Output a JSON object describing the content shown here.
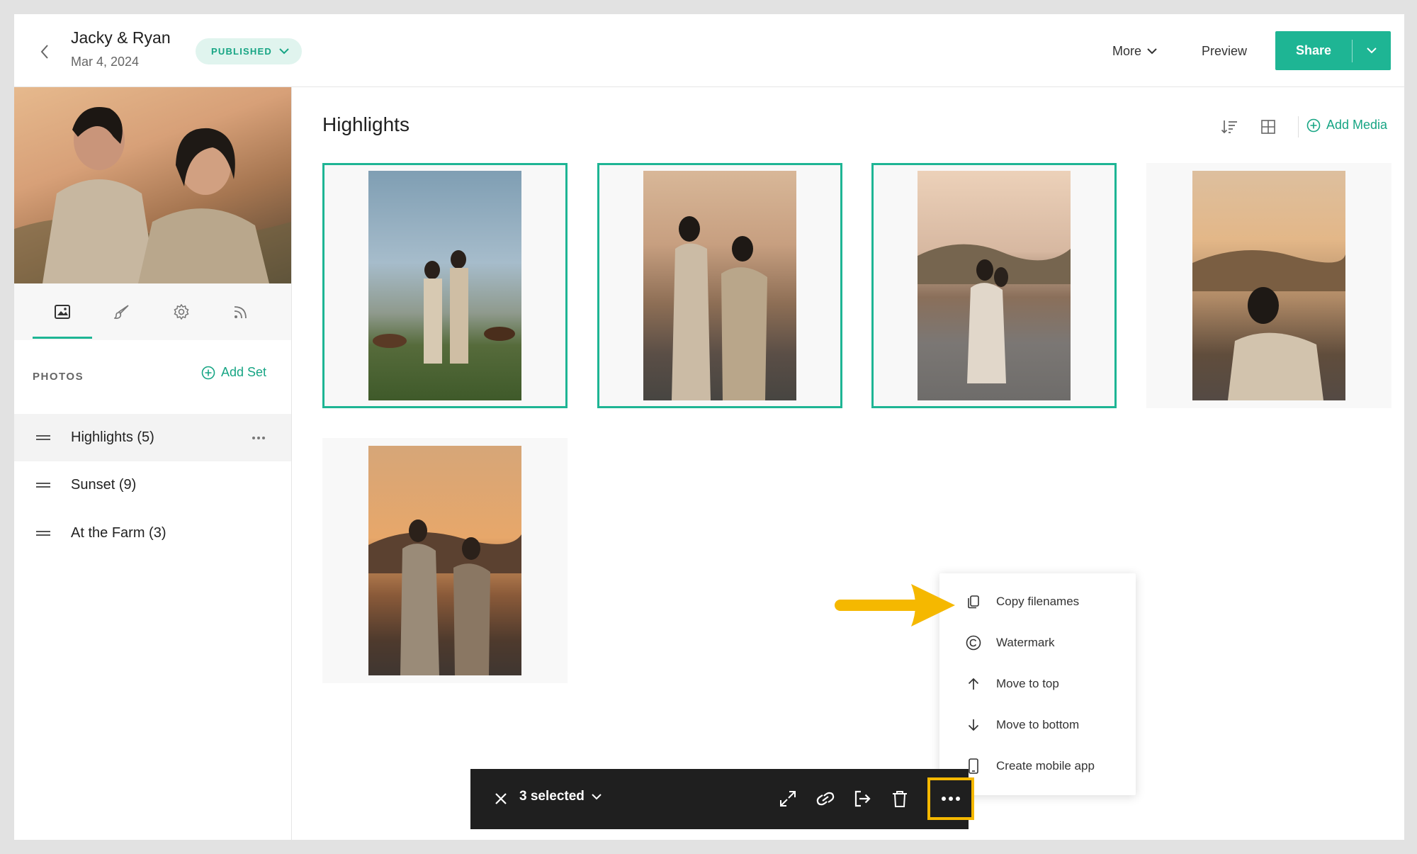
{
  "header": {
    "title": "Jacky & Ryan",
    "date": "Mar 4, 2024",
    "status": "PUBLISHED",
    "more_label": "More",
    "preview_label": "Preview",
    "share_label": "Share"
  },
  "sidebar": {
    "photos_label": "PHOTOS",
    "add_set_label": "Add Set",
    "sets": [
      {
        "label": "Highlights (5)",
        "active": true
      },
      {
        "label": "Sunset (9)",
        "active": false
      },
      {
        "label": "At the Farm (3)",
        "active": false
      }
    ]
  },
  "main": {
    "title": "Highlights",
    "add_media_label": "Add Media",
    "photos": [
      {
        "selected": true
      },
      {
        "selected": true
      },
      {
        "selected": true
      },
      {
        "selected": false
      },
      {
        "selected": false
      }
    ]
  },
  "context_menu": {
    "items": [
      {
        "label": "Copy filenames",
        "icon": "copy-icon"
      },
      {
        "label": "Watermark",
        "icon": "copyright-icon"
      },
      {
        "label": "Move to top",
        "icon": "arrow-up-icon"
      },
      {
        "label": "Move to bottom",
        "icon": "arrow-down-icon"
      },
      {
        "label": "Create mobile app",
        "icon": "mobile-icon"
      }
    ]
  },
  "action_bar": {
    "selected_label": "3 selected"
  },
  "colors": {
    "accent": "#1eb594",
    "highlight": "#f5b800",
    "bar_bg": "#1f1f1f"
  }
}
